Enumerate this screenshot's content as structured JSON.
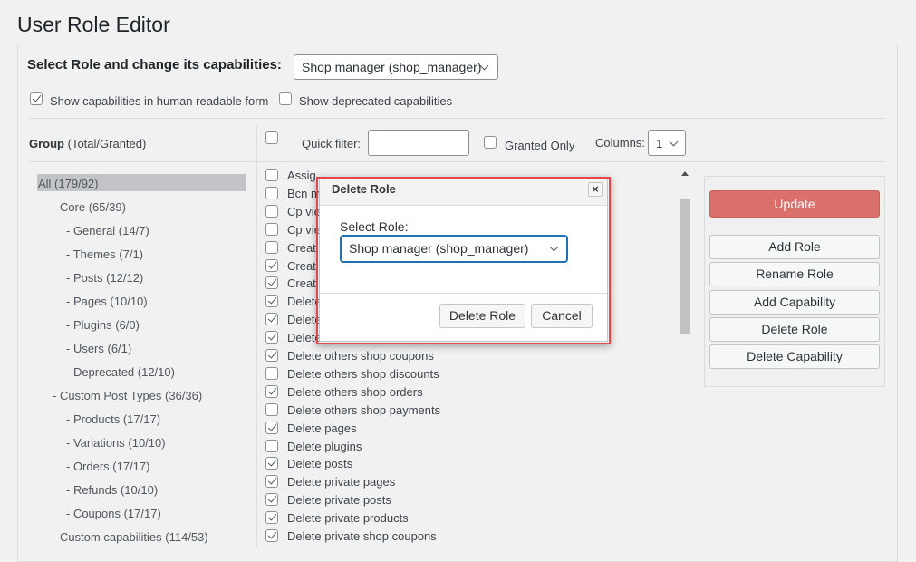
{
  "page": {
    "title": "User Role Editor"
  },
  "role_selector": {
    "label": "Select Role and change its capabilities:",
    "selected": "Shop manager (shop_manager)"
  },
  "options": {
    "human_readable": {
      "label": "Show capabilities in human readable form",
      "checked": true
    },
    "deprecated": {
      "label": "Show deprecated capabilities",
      "checked": false
    }
  },
  "group_header": {
    "title": "Group",
    "subtitle": "(Total/Granted)"
  },
  "groups": [
    {
      "label": "All (179/92)",
      "level": 0,
      "selected": true
    },
    {
      "label": "- Core (65/39)",
      "level": 1
    },
    {
      "label": "- General (14/7)",
      "level": 2
    },
    {
      "label": "- Themes (7/1)",
      "level": 2
    },
    {
      "label": "- Posts (12/12)",
      "level": 2
    },
    {
      "label": "- Pages (10/10)",
      "level": 2
    },
    {
      "label": "- Plugins (6/0)",
      "level": 2
    },
    {
      "label": "- Users (6/1)",
      "level": 2
    },
    {
      "label": "- Deprecated (12/10)",
      "level": 2
    },
    {
      "label": "- Custom Post Types (36/36)",
      "level": 1
    },
    {
      "label": "- Products (17/17)",
      "level": 2
    },
    {
      "label": "- Variations (10/10)",
      "level": 2
    },
    {
      "label": "- Orders (17/17)",
      "level": 2
    },
    {
      "label": "- Refunds (10/10)",
      "level": 2
    },
    {
      "label": "- Coupons (17/17)",
      "level": 2
    },
    {
      "label": "- Custom capabilities (114/53)",
      "level": 1
    }
  ],
  "filter_bar": {
    "quick_filter_label": "Quick filter:",
    "quick_filter_value": "",
    "granted_only_label": "Granted Only",
    "columns_label": "Columns:",
    "columns_value": "1"
  },
  "capabilities": [
    {
      "label": "Assig",
      "checked": false
    },
    {
      "label": "Bcn m",
      "checked": false
    },
    {
      "label": "Cp vie",
      "checked": false
    },
    {
      "label": "Cp vie",
      "checked": false
    },
    {
      "label": "Creat",
      "checked": false
    },
    {
      "label": "Creat",
      "checked": true
    },
    {
      "label": "Creat",
      "checked": true
    },
    {
      "label": "Delete",
      "checked": true
    },
    {
      "label": "Delete",
      "checked": true
    },
    {
      "label": "Delete",
      "checked": true
    },
    {
      "label": "Delete others shop coupons",
      "checked": true
    },
    {
      "label": "Delete others shop discounts",
      "checked": false
    },
    {
      "label": "Delete others shop orders",
      "checked": true
    },
    {
      "label": "Delete others shop payments",
      "checked": false
    },
    {
      "label": "Delete pages",
      "checked": true
    },
    {
      "label": "Delete plugins",
      "checked": false
    },
    {
      "label": "Delete posts",
      "checked": true
    },
    {
      "label": "Delete private pages",
      "checked": true
    },
    {
      "label": "Delete private posts",
      "checked": true
    },
    {
      "label": "Delete private products",
      "checked": true
    },
    {
      "label": "Delete private shop coupons",
      "checked": true
    }
  ],
  "actions": {
    "update": "Update",
    "add_role": "Add Role",
    "rename_role": "Rename Role",
    "add_capability": "Add Capability",
    "delete_role": "Delete Role",
    "delete_capability": "Delete Capability"
  },
  "dialog": {
    "title": "Delete Role",
    "close": "×",
    "select_label": "Select Role:",
    "selected_role": "Shop manager (shop_manager)",
    "confirm": "Delete Role",
    "cancel": "Cancel"
  }
}
